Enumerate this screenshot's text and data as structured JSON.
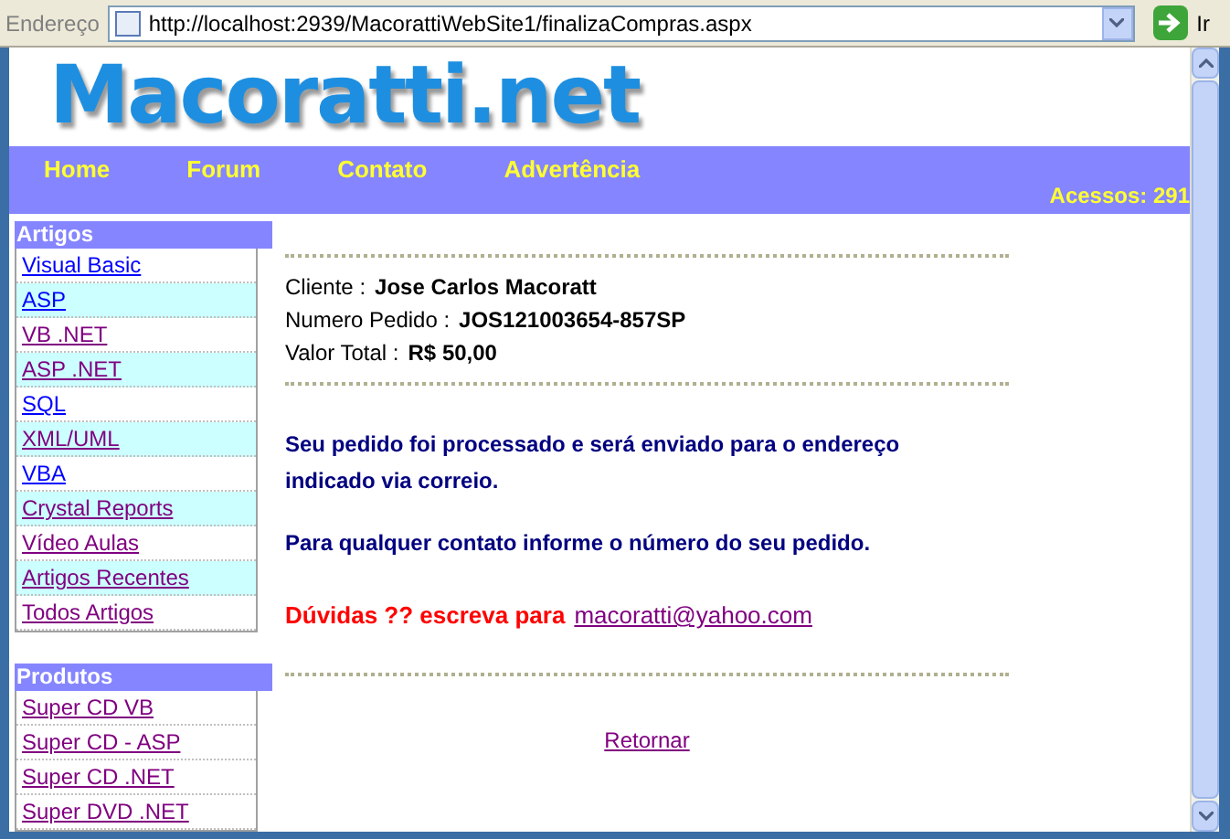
{
  "address_bar": {
    "label": "Endereço",
    "url": "http://localhost:2939/MacorattiWebSite1/finalizaCompras.aspx",
    "go_label": "Ir"
  },
  "logo": {
    "text": "Macoratti.net"
  },
  "nav": {
    "items": [
      "Home",
      "Forum",
      "Contato",
      "Advertência"
    ],
    "counter": "Acessos: 291"
  },
  "sidebar": [
    {
      "title": "Artigos",
      "items": [
        {
          "label": "Visual Basic",
          "visited": false,
          "shaded": false
        },
        {
          "label": "ASP",
          "visited": false,
          "shaded": true
        },
        {
          "label": "VB .NET",
          "visited": true,
          "shaded": false
        },
        {
          "label": "ASP .NET",
          "visited": true,
          "shaded": true
        },
        {
          "label": "SQL",
          "visited": false,
          "shaded": false
        },
        {
          "label": "XML/UML",
          "visited": true,
          "shaded": true
        },
        {
          "label": "VBA",
          "visited": false,
          "shaded": false
        },
        {
          "label": "Crystal Reports",
          "visited": true,
          "shaded": true
        },
        {
          "label": "Vídeo Aulas",
          "visited": true,
          "shaded": false
        },
        {
          "label": "Artigos Recentes",
          "visited": true,
          "shaded": true
        },
        {
          "label": "Todos Artigos",
          "visited": true,
          "shaded": false
        }
      ]
    },
    {
      "title": "Produtos",
      "items": [
        {
          "label": "Super CD VB",
          "visited": true,
          "shaded": false
        },
        {
          "label": "Super CD - ASP",
          "visited": true,
          "shaded": false
        },
        {
          "label": "Super CD .NET",
          "visited": true,
          "shaded": false
        },
        {
          "label": "Super DVD .NET",
          "visited": true,
          "shaded": false
        }
      ]
    }
  ],
  "order": [
    {
      "label": "Cliente :",
      "value": "Jose Carlos Macoratt"
    },
    {
      "label": "Numero Pedido :",
      "value": "JOS121003654-857SP"
    },
    {
      "label": "Valor Total :",
      "value": "R$ 50,00"
    }
  ],
  "messages": [
    "Seu pedido foi processado e será enviado para o endereço indicado via correio.",
    "Para qualquer contato informe o número do seu  pedido."
  ],
  "question": {
    "text": "Dúvidas ?? escreva para",
    "email": "macoratti@yahoo.com"
  },
  "return_link": "Retornar"
}
